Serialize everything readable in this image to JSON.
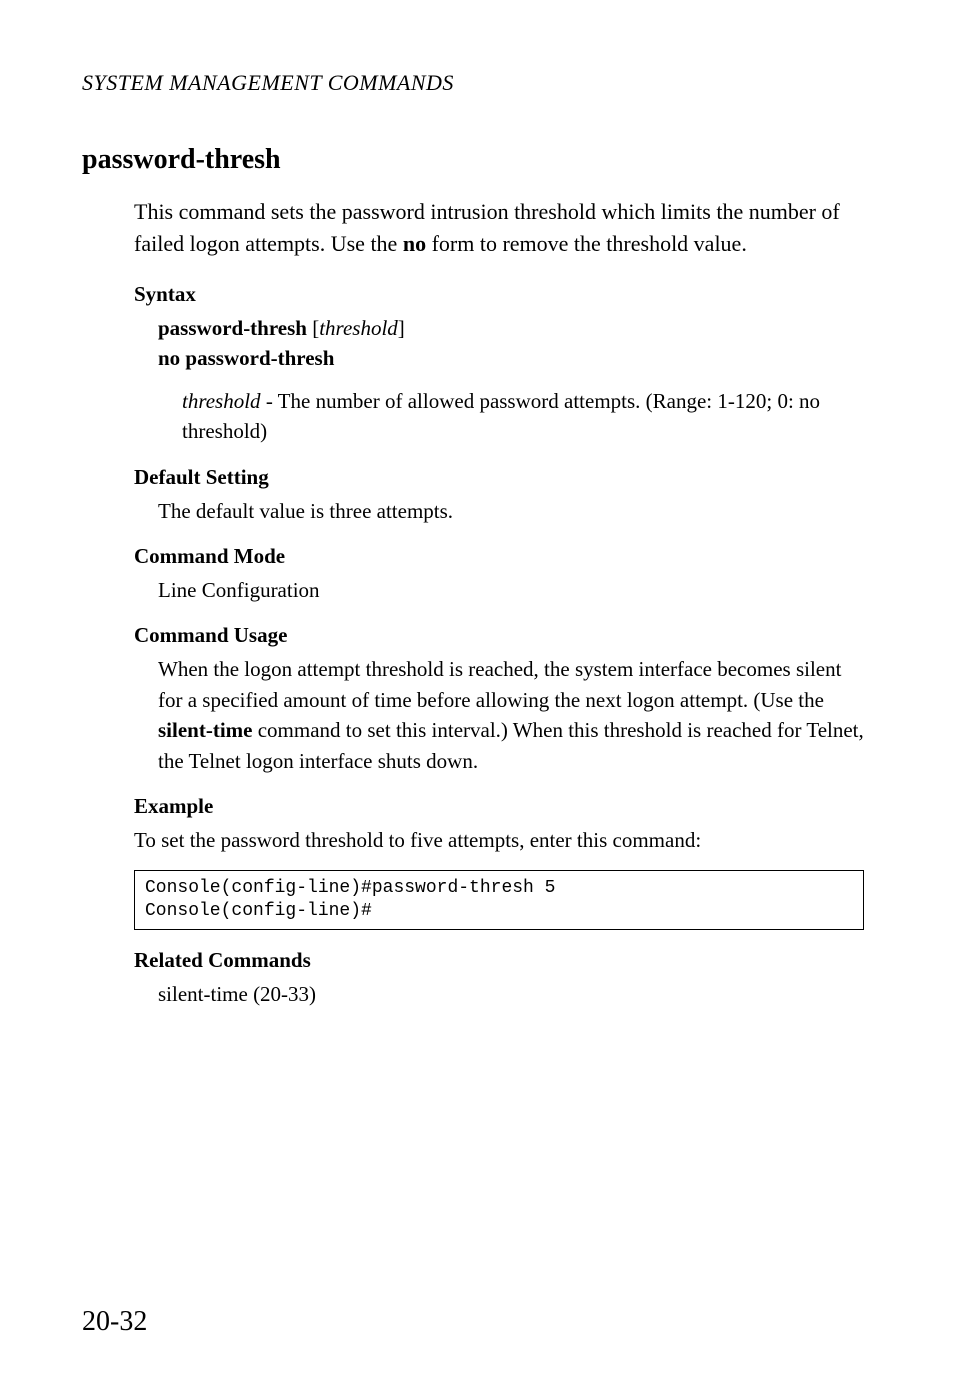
{
  "running_header": "SYSTEM MANAGEMENT COMMANDS",
  "section_title": "password-thresh",
  "intro_pre": "This command sets the password intrusion threshold which limits the number of failed logon attempts. Use the ",
  "intro_bold": "no",
  "intro_post": " form to remove the threshold value.",
  "syntax_head": "Syntax",
  "syntax_line1_bold": "password-thresh",
  "syntax_line1_open": " [",
  "syntax_line1_ital": "threshold",
  "syntax_line1_close": "]",
  "syntax_line2": "no password-thresh",
  "param_ital": "threshold",
  "param_rest": " - The number of allowed password attempts. (Range: 1-120; 0: no threshold)",
  "default_head": "Default Setting",
  "default_body": "The default value is three attempts.",
  "mode_head": "Command Mode",
  "mode_body": "Line Configuration",
  "usage_head": "Command Usage",
  "usage_pre": "When the logon attempt threshold is reached, the system interface becomes silent for a specified amount of time before allowing the next logon attempt. (Use the ",
  "usage_bold": "silent-time",
  "usage_post": " command to set this interval.) When this threshold is reached for Telnet, the Telnet logon interface shuts down.",
  "example_head": "Example",
  "example_intro": "To set the password threshold to five attempts, enter this command:",
  "code": "Console(config-line)#password-thresh 5\nConsole(config-line)#",
  "related_head": "Related Commands",
  "related_body": "silent-time (20-33)",
  "page_number": "20-32"
}
